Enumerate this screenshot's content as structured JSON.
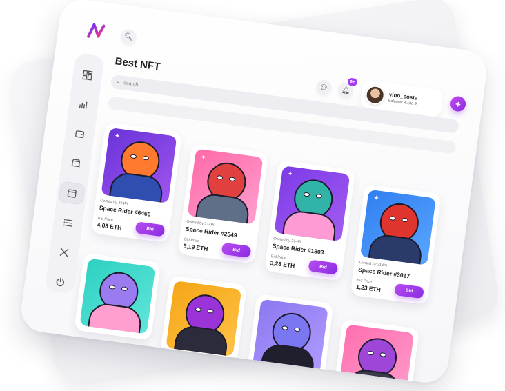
{
  "header": {
    "title": "Best NFT",
    "notification_badge": "9+",
    "search_placeholder": "search"
  },
  "user": {
    "name": "vino_costa",
    "balance": "Balance: 4,100 ₽"
  },
  "sidebar": {
    "items": [
      {
        "icon": "dashboard-icon"
      },
      {
        "icon": "stats-icon"
      },
      {
        "icon": "wallet-icon"
      },
      {
        "icon": "shop-icon"
      },
      {
        "icon": "gallery-icon",
        "active": true
      },
      {
        "icon": "list-icon"
      },
      {
        "icon": "tools-icon"
      },
      {
        "icon": "power-icon"
      }
    ]
  },
  "cards": [
    {
      "owner": "Owned by 314Pi",
      "name": "Space Rider #6466",
      "bid_label": "Bid Price",
      "price": "4,03 ETH",
      "button": "Bid"
    },
    {
      "owner": "Owned by 314Pi",
      "name": "Space Rider #2549",
      "bid_label": "Bid Price",
      "price": "5,19 ETH",
      "button": "Bid"
    },
    {
      "owner": "Owned by 314Pi",
      "name": "Space Rider #1803",
      "bid_label": "Bid Price",
      "price": "3,28 ETH",
      "button": "Bid"
    },
    {
      "owner": "Owned by 314Pi",
      "name": "Space Rider #3017",
      "bid_label": "Bid Price",
      "price": "1,23 ETH",
      "button": "Bid"
    }
  ],
  "colors": {
    "accent": "#9b30ea",
    "card1_bg": "#7b3fe0",
    "card2_bg": "#ff7ab8",
    "card3_bg": "#8e44e8",
    "card4_bg": "#3b86f0",
    "card5_bg": "#35d3c6",
    "card6_bg": "#f7b21e",
    "card7_bg": "#8f7cf2",
    "card8_bg": "#ff7fb9"
  }
}
